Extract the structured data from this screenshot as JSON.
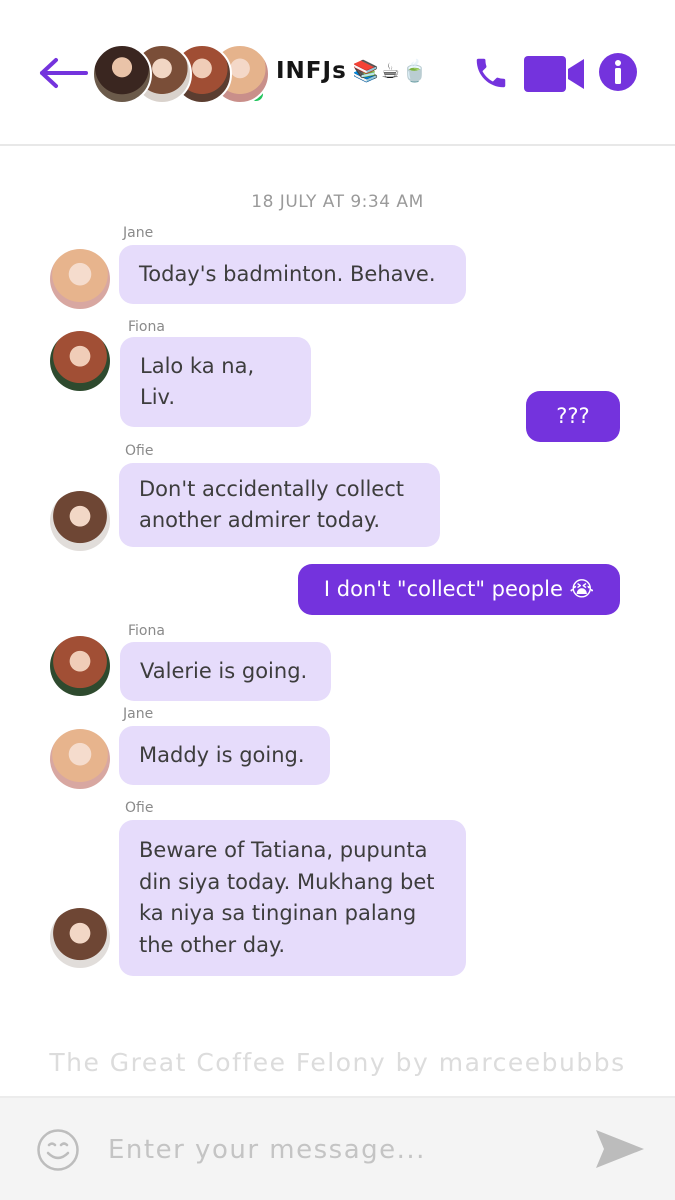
{
  "header": {
    "group_name": "INFJs",
    "group_emoji": "📚☕🍵",
    "members": [
      "member-1",
      "member-2",
      "member-3",
      "member-4"
    ],
    "online": true
  },
  "colors": {
    "accent": "#7433dd",
    "incoming_bubble": "#e6dcfb",
    "online": "#22c55e"
  },
  "chat": {
    "timestamp": "18 JULY AT 9:34 AM",
    "messages": [
      {
        "sender": "Jane",
        "direction": "in",
        "text": "Today's badminton. Behave."
      },
      {
        "sender": "Fiona",
        "direction": "in",
        "text": "Lalo ka na, Liv."
      },
      {
        "sender": "",
        "direction": "out",
        "text": "???"
      },
      {
        "sender": "Ofie",
        "direction": "in",
        "text": "Don't accidentally collect another admirer today."
      },
      {
        "sender": "",
        "direction": "out",
        "text": "I don't \"collect\" people 😭"
      },
      {
        "sender": "Fiona",
        "direction": "in",
        "text": "Valerie is going."
      },
      {
        "sender": "Jane",
        "direction": "in",
        "text": "Maddy is going."
      },
      {
        "sender": "Ofie",
        "direction": "in",
        "text": "Beware of Tatiana, pupunta din siya today. Mukhang bet ka niya sa tinginan palang the other day."
      }
    ]
  },
  "credit": "The Great Coffee Felony by marceebubbs",
  "composer": {
    "placeholder": "Enter your message...",
    "value": ""
  },
  "icons": {
    "back": "back-arrow-icon",
    "call": "phone-icon",
    "video": "video-camera-icon",
    "info": "info-icon",
    "emoji": "smiley-icon",
    "send": "send-icon"
  }
}
